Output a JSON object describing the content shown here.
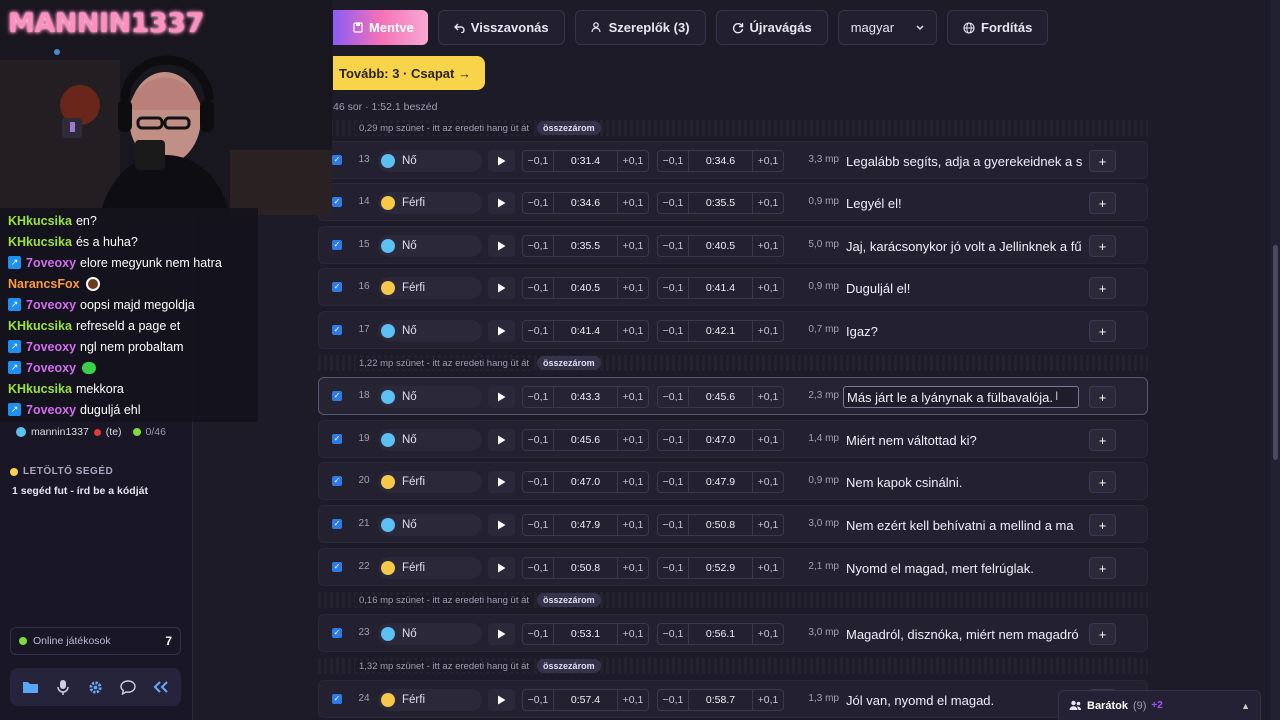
{
  "streamer_name": "MANNIN1337",
  "toolbar": {
    "save": "Mentve",
    "undo": "Visszavonás",
    "actors": "Szereplők (3)",
    "recut": "Újravágás",
    "language": "magyar",
    "translate": "Fordítás"
  },
  "next_button": "Tovább: 3 · Csapat →",
  "stats": "46 sor · 1:52.1 beszéd",
  "collapse_label": "összezárom",
  "adj": {
    "minus": "−0,1",
    "plus": "+0,1"
  },
  "gaps": [
    {
      "text": "0,29 mp szünet - itt az eredeti hang üt át"
    },
    {
      "text": "1,22 mp szünet - itt az eredeti hang üt át"
    },
    {
      "text": "0,16 mp szünet - itt az eredeti hang üt át"
    },
    {
      "text": "1,32 mp szünet - itt az eredeti hang üt át"
    }
  ],
  "colors": {
    "female": "#5cc0f2",
    "male": "#f7c948",
    "accent": "#8b5cf6",
    "next": "#f7d44a"
  },
  "rows": [
    {
      "idx": "13",
      "speaker": "Nő",
      "start": "0:31.4",
      "end": "0:34.6",
      "dur": "3,3 mp",
      "text": "Legalább segíts, adja a gyerekeidnek a s"
    },
    {
      "idx": "14",
      "speaker": "Férfi",
      "start": "0:34.6",
      "end": "0:35.5",
      "dur": "0,9 mp",
      "text": "Legyél el!"
    },
    {
      "idx": "15",
      "speaker": "Nő",
      "start": "0:35.5",
      "end": "0:40.5",
      "dur": "5,0 mp",
      "text": "Jaj, karácsonykor jó volt a Jellinknek a fű"
    },
    {
      "idx": "16",
      "speaker": "Férfi",
      "start": "0:40.5",
      "end": "0:41.4",
      "dur": "0,9 mp",
      "text": "Duguljál el!"
    },
    {
      "idx": "17",
      "speaker": "Nő",
      "start": "0:41.4",
      "end": "0:42.1",
      "dur": "0,7 mp",
      "text": "Igaz?"
    },
    {
      "idx": "18",
      "speaker": "Nő",
      "start": "0:43.3",
      "end": "0:45.6",
      "dur": "2,3 mp",
      "text": "Más járt le a lyánynak a fülbavalója."
    },
    {
      "idx": "19",
      "speaker": "Nő",
      "start": "0:45.6",
      "end": "0:47.0",
      "dur": "1,4 mp",
      "text": "Miért nem váltottad ki?"
    },
    {
      "idx": "20",
      "speaker": "Férfi",
      "start": "0:47.0",
      "end": "0:47.9",
      "dur": "0,9 mp",
      "text": "Nem kapok csinálni."
    },
    {
      "idx": "21",
      "speaker": "Nő",
      "start": "0:47.9",
      "end": "0:50.8",
      "dur": "3,0 mp",
      "text": "Nem ezért kell behívatni a mellind a ma"
    },
    {
      "idx": "22",
      "speaker": "Férfi",
      "start": "0:50.8",
      "end": "0:52.9",
      "dur": "2,1 mp",
      "text": "Nyomd el magad, mert felrúglak."
    },
    {
      "idx": "23",
      "speaker": "Nő",
      "start": "0:53.1",
      "end": "0:56.1",
      "dur": "3,0 mp",
      "text": "Magadról, disznóka, miért nem magadró"
    },
    {
      "idx": "24",
      "speaker": "Férfi",
      "start": "0:57.4",
      "end": "0:58.7",
      "dur": "1,3 mp",
      "text": "Jól van, nyomd el magad."
    }
  ],
  "chat": [
    {
      "name": "KHkucsika",
      "color": "#9be33b",
      "badge": false,
      "msg": "en?"
    },
    {
      "name": "KHkucsika",
      "color": "#9be33b",
      "badge": false,
      "msg": "és a huha?"
    },
    {
      "name": "7oveoxy",
      "color": "#d36cf0",
      "badge": true,
      "msg": "elore megyunk nem hatra"
    },
    {
      "name": "NarancsFox",
      "color": "#ff9a3c",
      "badge": false,
      "msg": ""
    },
    {
      "name": "7oveoxy",
      "color": "#d36cf0",
      "badge": true,
      "msg": "oopsi majd megoldja"
    },
    {
      "name": "KHkucsika",
      "color": "#9be33b",
      "badge": false,
      "msg": "refreseld a page et"
    },
    {
      "name": "7oveoxy",
      "color": "#d36cf0",
      "badge": true,
      "msg": "ngl nem probaltam"
    },
    {
      "name": "7oveoxy",
      "color": "#d36cf0",
      "badge": true,
      "msg": ""
    },
    {
      "name": "KHkucsika",
      "color": "#9be33b",
      "badge": false,
      "msg": "mekkora"
    },
    {
      "name": "7oveoxy",
      "color": "#d36cf0",
      "badge": true,
      "msg": "duguljá ehl"
    }
  ],
  "sidebar": {
    "user": "mannin1337",
    "you": "(te)",
    "count": "0/46",
    "helper_title": "LETÖLTŐ SEGÉD",
    "helper_sub": "1 segéd fut - írd be a kódját",
    "online_label": "Online játékosok",
    "online_count": "7"
  },
  "friends": {
    "label": "Barátok",
    "count": "(9)",
    "plus": "+2"
  }
}
